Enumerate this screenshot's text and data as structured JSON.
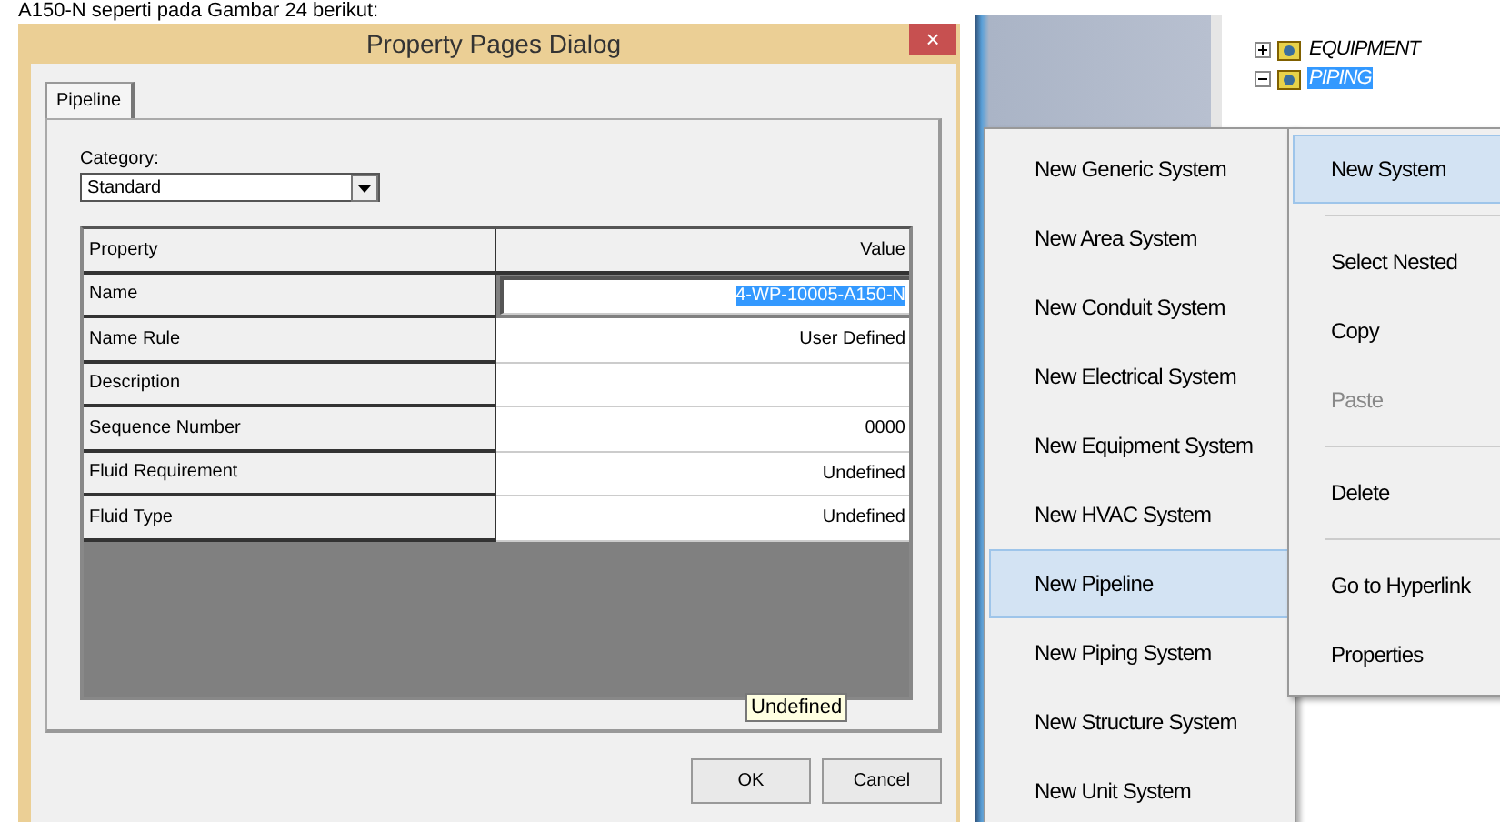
{
  "caption": "A150-N seperti pada Gambar 24 berikut:",
  "dialog": {
    "title": "Property Pages Dialog",
    "close": "×",
    "tabs": [
      {
        "label": "Pipeline",
        "selected": true
      }
    ],
    "category": {
      "label": "Category:",
      "value": "Standard"
    },
    "grid": {
      "columns": [
        "Property",
        "Value"
      ],
      "rows": [
        {
          "property": "Name",
          "value": "4-WP-10005-A150-N",
          "editing": true
        },
        {
          "property": "Name Rule",
          "value": "User Defined",
          "editing": false
        },
        {
          "property": "Description",
          "value": "",
          "editing": false
        },
        {
          "property": "Sequence Number",
          "value": "0000",
          "editing": false
        },
        {
          "property": "Fluid Requirement",
          "value": "Undefined",
          "editing": false
        },
        {
          "property": "Fluid Type",
          "value": "Undefined",
          "editing": false
        }
      ]
    },
    "tooltip": "Undefined",
    "buttons": [
      "OK",
      "Cancel"
    ]
  },
  "tree": {
    "items": [
      {
        "label": "EQUIPMENT",
        "expanded": false,
        "selected": false
      },
      {
        "label": "PIPING",
        "expanded": true,
        "selected": true
      }
    ]
  },
  "submenu": {
    "items": [
      {
        "label": "New Generic System",
        "highlighted": false
      },
      {
        "label": "New Area System",
        "highlighted": false
      },
      {
        "label": "New Conduit System",
        "highlighted": false
      },
      {
        "label": "New Electrical System",
        "highlighted": false
      },
      {
        "label": "New Equipment System",
        "highlighted": false
      },
      {
        "label": "New HVAC System",
        "highlighted": false
      },
      {
        "label": "New Pipeline",
        "highlighted": true
      },
      {
        "label": "New Piping System",
        "highlighted": false
      },
      {
        "label": "New Structure System",
        "highlighted": false
      },
      {
        "label": "New Unit System",
        "highlighted": false
      }
    ]
  },
  "context_menu": {
    "items": [
      {
        "label": "New System",
        "highlighted": true,
        "disabled": false,
        "separator_after": true
      },
      {
        "label": "Select Nested",
        "highlighted": false,
        "disabled": false,
        "separator_after": false
      },
      {
        "label": "Copy",
        "highlighted": false,
        "disabled": false,
        "separator_after": false
      },
      {
        "label": "Paste",
        "highlighted": false,
        "disabled": true,
        "separator_after": true
      },
      {
        "label": "Delete",
        "highlighted": false,
        "disabled": false,
        "separator_after": true
      },
      {
        "label": "Go to Hyperlink",
        "highlighted": false,
        "disabled": false,
        "separator_after": false
      },
      {
        "label": "Properties",
        "highlighted": false,
        "disabled": false,
        "separator_after": false
      }
    ]
  }
}
